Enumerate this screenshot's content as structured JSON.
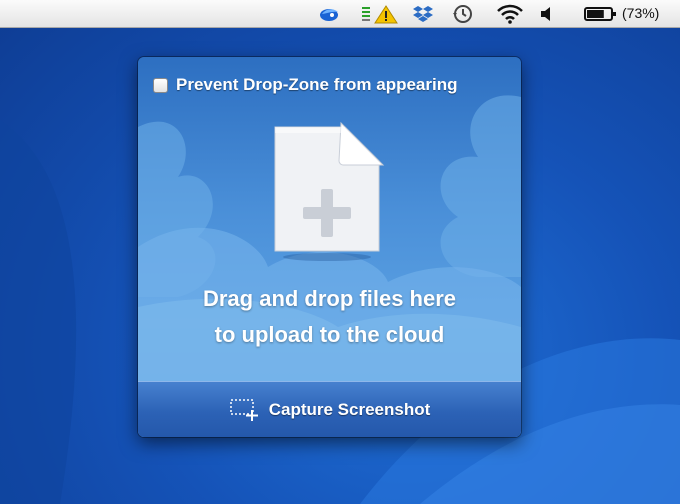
{
  "menubar": {
    "icons": [
      "edge-bird-icon",
      "signal-warning-icon",
      "dropbox-icon",
      "time-machine-icon",
      "wifi-icon",
      "volume-icon",
      "battery-icon"
    ],
    "battery_percent": "(73%)",
    "battery_level": 0.73
  },
  "panel": {
    "prevent_label": "Prevent Drop-Zone from appearing",
    "prevent_checked": false,
    "drop_line1": "Drag and drop files here",
    "drop_line2": "to upload to the cloud",
    "capture_label": "Capture Screenshot"
  },
  "colors": {
    "desktop": "#1553b8",
    "panel_top": "#2d6fc1",
    "panel_mid": "#5aa0e2",
    "button": "#2c62b6",
    "warning": "#f5c400"
  }
}
